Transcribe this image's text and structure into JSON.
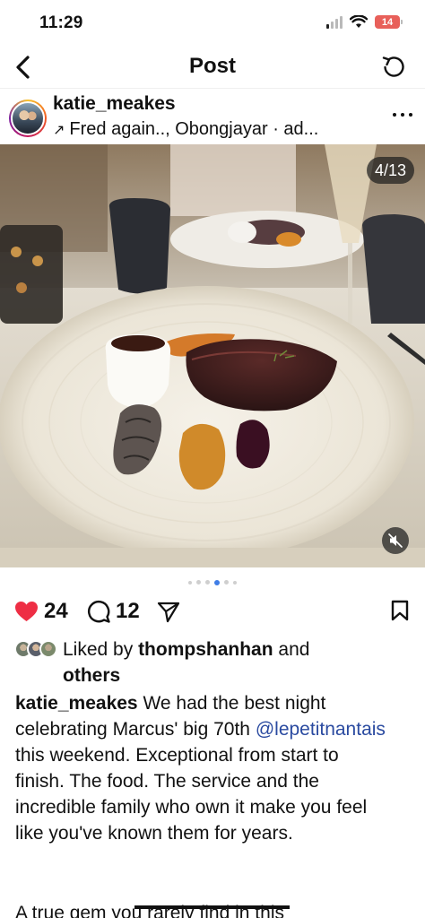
{
  "status_bar": {
    "time": "11:29",
    "battery": "14"
  },
  "nav": {
    "title": "Post"
  },
  "author": {
    "username": "katie_meakes",
    "music_arrow": "↗",
    "music": "Fred again.., Obongjayar · ad..."
  },
  "media": {
    "counter": "4/13",
    "carousel_dot_count": 6,
    "active_dot": 3
  },
  "actions": {
    "likes": "24",
    "comments": "12"
  },
  "liked_by": {
    "prefix": "Liked by",
    "user": "thompshanhan",
    "suffix": "and",
    "others": "others"
  },
  "caption": {
    "username": "katie_meakes",
    "text_1": "We had the best night celebrating Marcus' big 70th",
    "mention": "@lepetitnantais",
    "text_2": "this weekend. Exceptional from start to finish. The food. The service and the incredible family who own it make you feel like you've known them for years.",
    "text_3": "A true gem you rarely find in this"
  },
  "colors": {
    "like_red": "#ee2e44",
    "mention_blue": "#2a4aa0",
    "active_dot": "#3f7de6"
  }
}
